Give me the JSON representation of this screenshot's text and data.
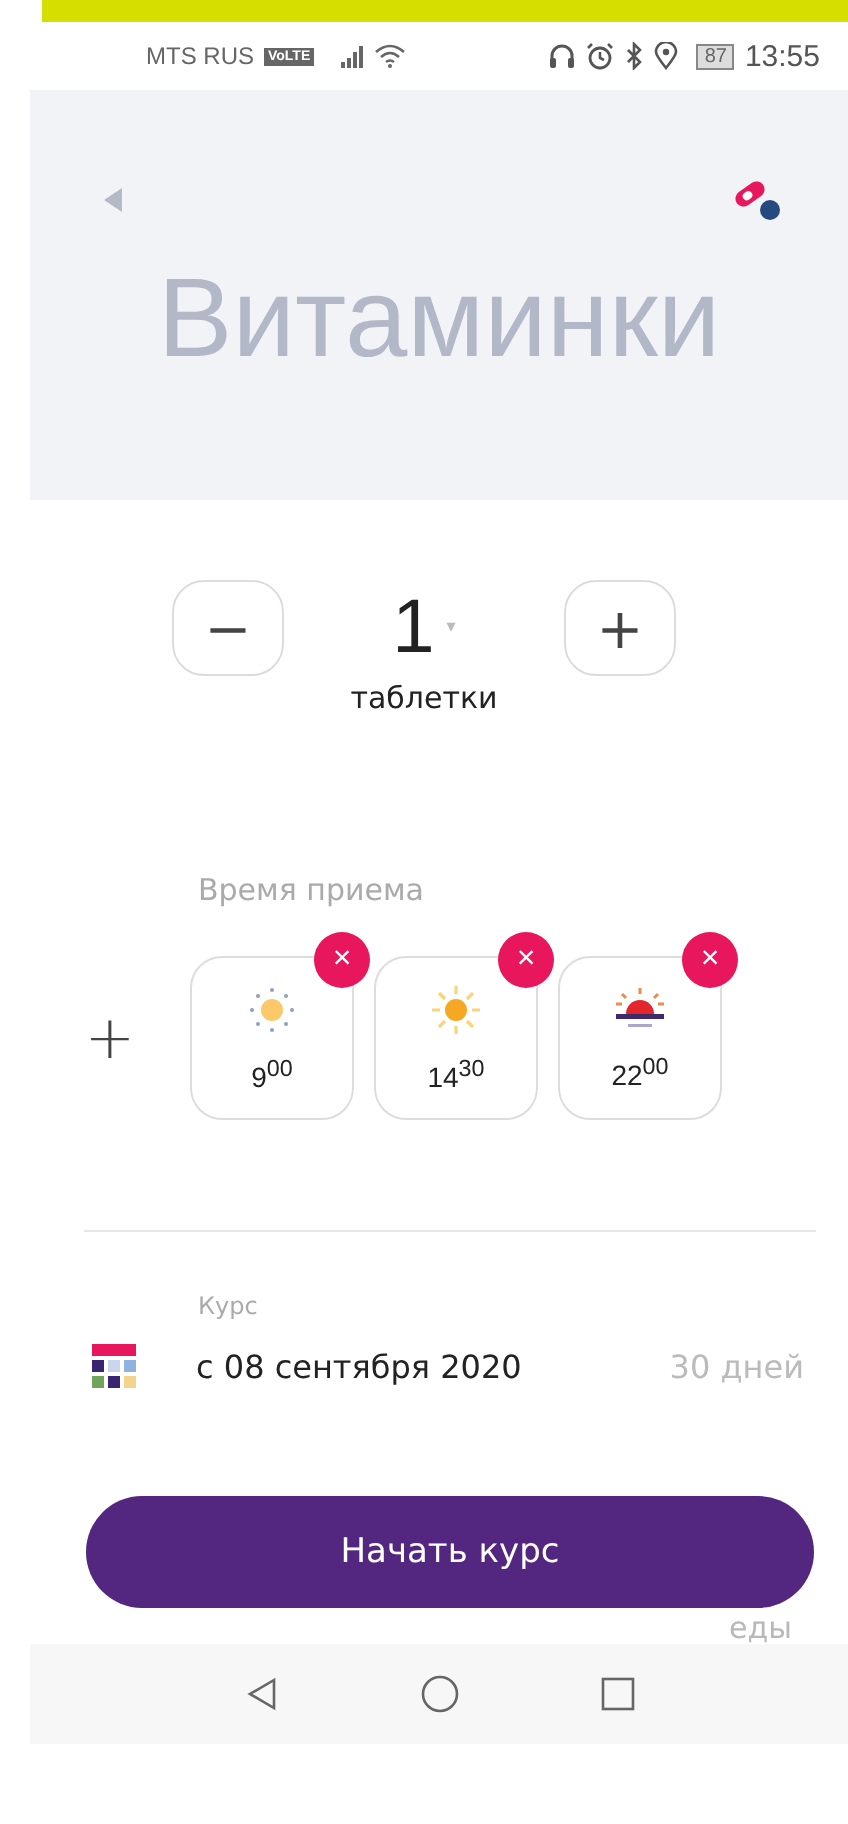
{
  "status_bar": {
    "carrier": "MTS RUS",
    "volte": "VoLTE",
    "battery": "87",
    "time": "13:55"
  },
  "header": {
    "title": "Витаминки"
  },
  "dose": {
    "minus": "−",
    "value": "1",
    "caret": "▾",
    "plus": "+",
    "unit": "таблетки"
  },
  "intake": {
    "label": "Время приема",
    "add": "+",
    "times": [
      {
        "kind": "morning",
        "time": "9$^{00}$",
        "remove": "×"
      },
      {
        "kind": "day",
        "time": "14$^{30}$",
        "remove": "×"
      },
      {
        "kind": "evening",
        "time": "22$^{00}$",
        "remove": "×"
      }
    ]
  },
  "course": {
    "label": "Курс",
    "start": "с 08 сентября 2020",
    "duration": "30 дней"
  },
  "faded_text": "еды",
  "start_button": "Начать курс"
}
